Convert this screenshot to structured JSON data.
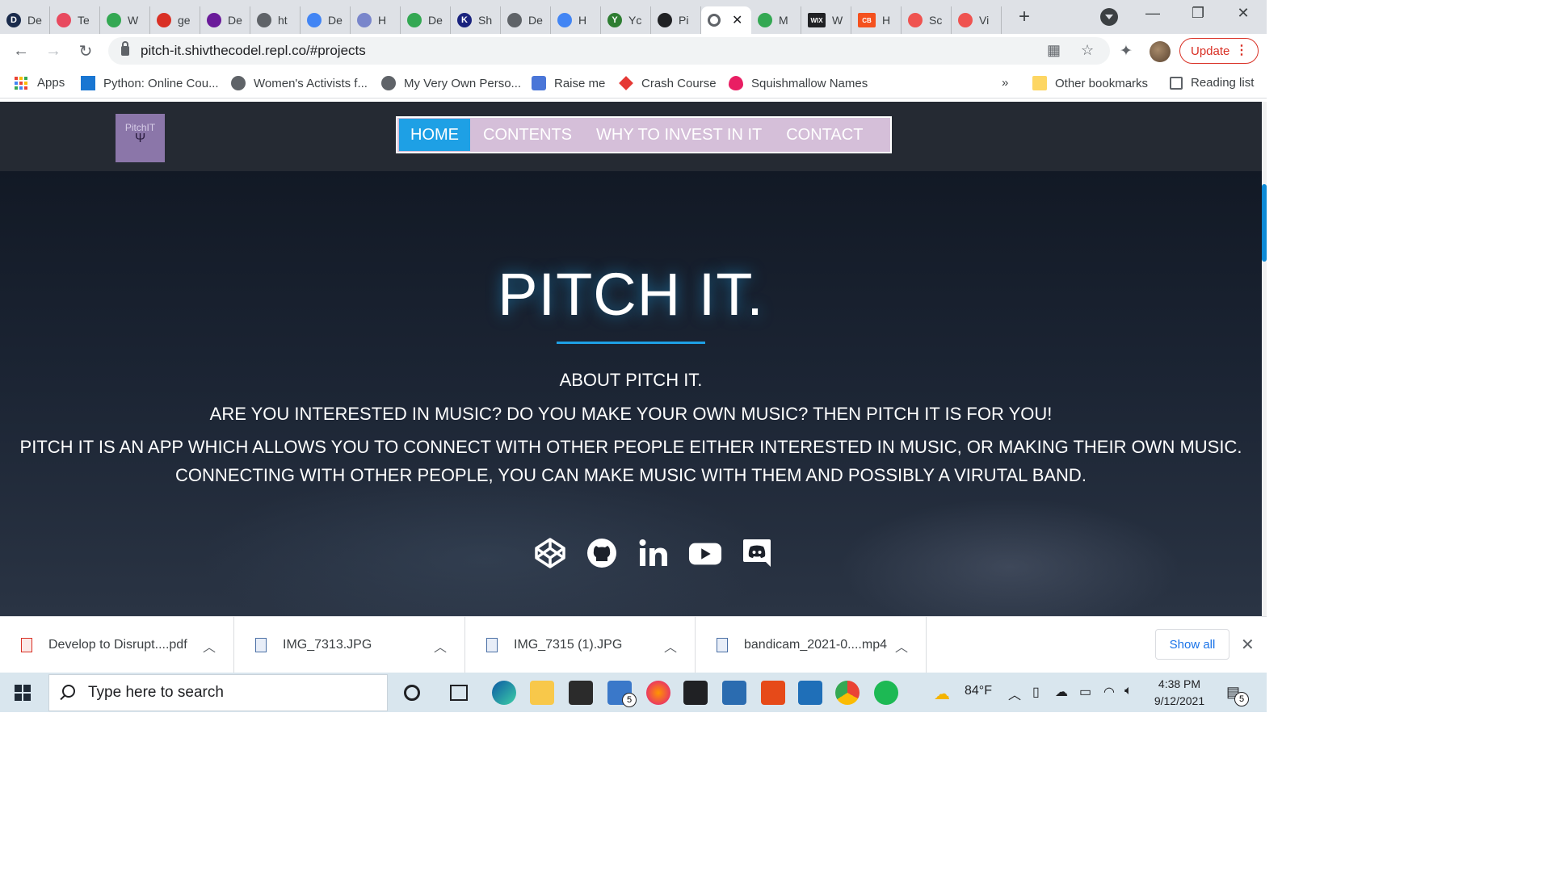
{
  "browser": {
    "tabs": [
      {
        "label": "De",
        "color": "#1a2b4c",
        "glyph": "D"
      },
      {
        "label": "Te",
        "color": "#e84a5f",
        "glyph": ""
      },
      {
        "label": "W",
        "color": "#34a853",
        "glyph": ""
      },
      {
        "label": "ge",
        "color": "#d93025",
        "glyph": ""
      },
      {
        "label": "De",
        "color": "#6a1b9a",
        "glyph": ""
      },
      {
        "label": "ht",
        "color": "#5f6368",
        "glyph": ""
      },
      {
        "label": "De",
        "color": "#4285f4",
        "glyph": ""
      },
      {
        "label": "H",
        "color": "#7986cb",
        "glyph": ""
      },
      {
        "label": "De",
        "color": "#34a853",
        "glyph": ""
      },
      {
        "label": "Sh",
        "color": "#1a237e",
        "glyph": "K"
      },
      {
        "label": "De",
        "color": "#5f6368",
        "glyph": ""
      },
      {
        "label": "H",
        "color": "#4285f4",
        "glyph": ""
      },
      {
        "label": "Yc",
        "color": "#2e7d32",
        "glyph": "Y"
      },
      {
        "label": "Pi",
        "color": "#202124",
        "glyph": ""
      }
    ],
    "active_tab_icon": "replit-icon",
    "tabs_after": [
      {
        "label": "M",
        "color": "#34a853",
        "glyph": ""
      },
      {
        "label": "W",
        "color": "#202124",
        "glyph": "WIX"
      },
      {
        "label": "H",
        "color": "#f4511e",
        "glyph": "CB"
      },
      {
        "label": "Sc",
        "color": "#ef5350",
        "glyph": ""
      },
      {
        "label": "Vi",
        "color": "#ef5350",
        "glyph": ""
      }
    ],
    "url": "pitch-it.shivthecodel.repl.co/#projects",
    "update_label": "Update"
  },
  "bookmarks": {
    "items": [
      {
        "label": "Apps",
        "icon": "apps-grid-icon"
      },
      {
        "label": "Python: Online Cou...",
        "icon": "python-course-icon"
      },
      {
        "label": "Women's Activists f...",
        "icon": "globe-icon"
      },
      {
        "label": "My Very Own Perso...",
        "icon": "globe-icon"
      },
      {
        "label": "Raise me",
        "icon": "raise-me-icon"
      },
      {
        "label": "Crash Course",
        "icon": "crash-course-icon"
      },
      {
        "label": "Squishmallow Names",
        "icon": "flame-icon"
      }
    ],
    "overflow": "»",
    "other": "Other bookmarks",
    "reading_list": "Reading list"
  },
  "site": {
    "logo_text": "PitchIT",
    "nav": [
      {
        "label": "HOME",
        "active": true
      },
      {
        "label": "CONTENTS",
        "active": false
      },
      {
        "label": "WHY TO INVEST IN IT",
        "active": false
      },
      {
        "label": "CONTACT",
        "active": false
      }
    ],
    "hero": {
      "title": "PITCH IT.",
      "subtitle": "ABOUT PITCH IT.",
      "line1": "ARE YOU INTERESTED IN MUSIC? DO YOU MAKE YOUR OWN MUSIC? THEN PITCH IT IS FOR YOU!",
      "line2": "PITCH IT IS AN APP WHICH ALLOWS YOU TO CONNECT WITH OTHER PEOPLE EITHER INTERESTED IN MUSIC, OR MAKING THEIR OWN MUSIC.",
      "line3": "CONNECTING WITH OTHER PEOPLE, YOU CAN MAKE MUSIC WITH THEM AND POSSIBLY A VIRUTAL BAND."
    },
    "socials": [
      "codepen-icon",
      "github-icon",
      "linkedin-icon",
      "youtube-icon",
      "discord-icon"
    ],
    "accent": "#1ea0e5",
    "nav_bg": "#d5bfd9"
  },
  "downloads": {
    "items": [
      {
        "name": "Develop to Disrupt....pdf",
        "type": "pdf"
      },
      {
        "name": "IMG_7313.JPG",
        "type": "image"
      },
      {
        "name": "IMG_7315 (1).JPG",
        "type": "image"
      },
      {
        "name": "bandicam_2021-0....mp4",
        "type": "video"
      }
    ],
    "show_all": "Show all"
  },
  "taskbar": {
    "search_placeholder": "Type here to search",
    "weather": "84°F",
    "time": "4:38 PM",
    "date": "9/12/2021",
    "mail_badge": "5",
    "notif_badge": "5"
  }
}
